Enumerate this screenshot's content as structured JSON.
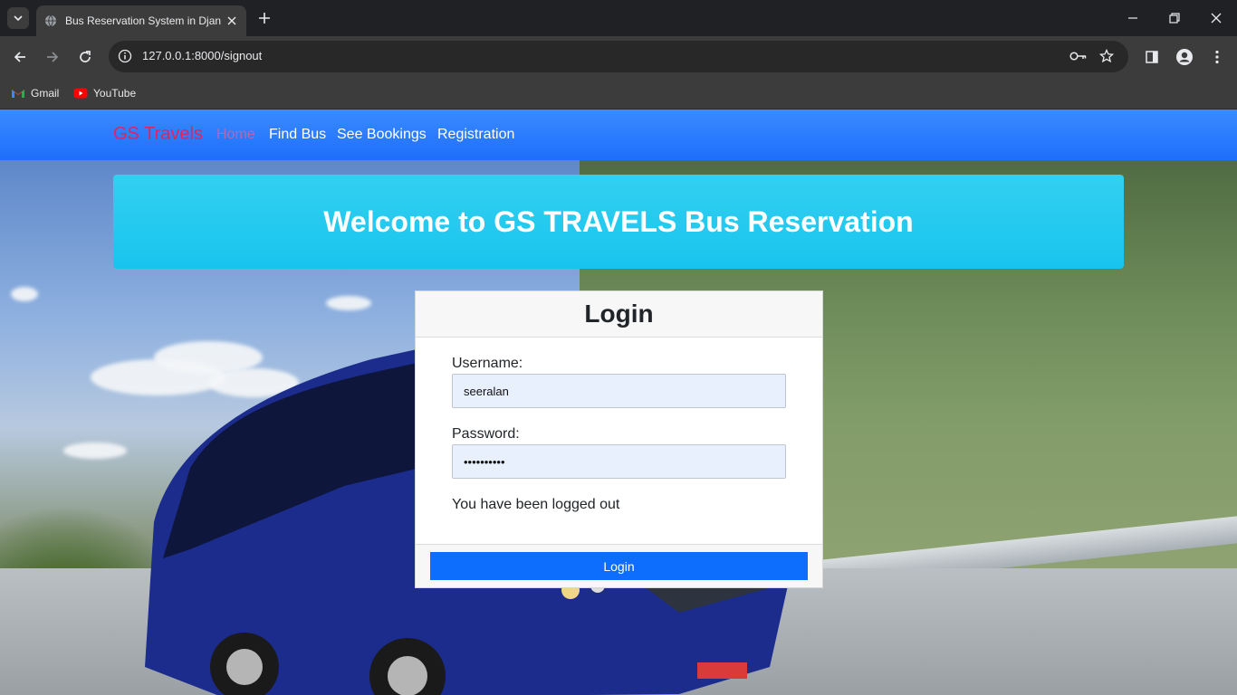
{
  "browser": {
    "tab_title": "Bus Reservation System in Djang",
    "url": "127.0.0.1:8000/signout",
    "bookmarks": [
      {
        "label": "Gmail",
        "icon": "gmail-icon"
      },
      {
        "label": "YouTube",
        "icon": "youtube-icon"
      }
    ]
  },
  "navbar": {
    "brand": "GS Travels",
    "links": [
      "Home",
      "Find Bus",
      "See Bookings",
      "Registration"
    ],
    "active": "Home"
  },
  "banner": {
    "title": "Welcome to GS TRAVELS Bus Reservation"
  },
  "login": {
    "title": "Login",
    "username_label": "Username:",
    "username_value": "seeralan",
    "password_label": "Password:",
    "password_value": "••••••••••",
    "message": "You have been logged out",
    "button_label": "Login"
  },
  "colors": {
    "navbar": "#1f6efc",
    "brand": "#e0245e",
    "active_link": "#b06ab3",
    "banner": "#18c4ee",
    "button": "#0d6efd",
    "input_bg": "#e8f0fe"
  }
}
